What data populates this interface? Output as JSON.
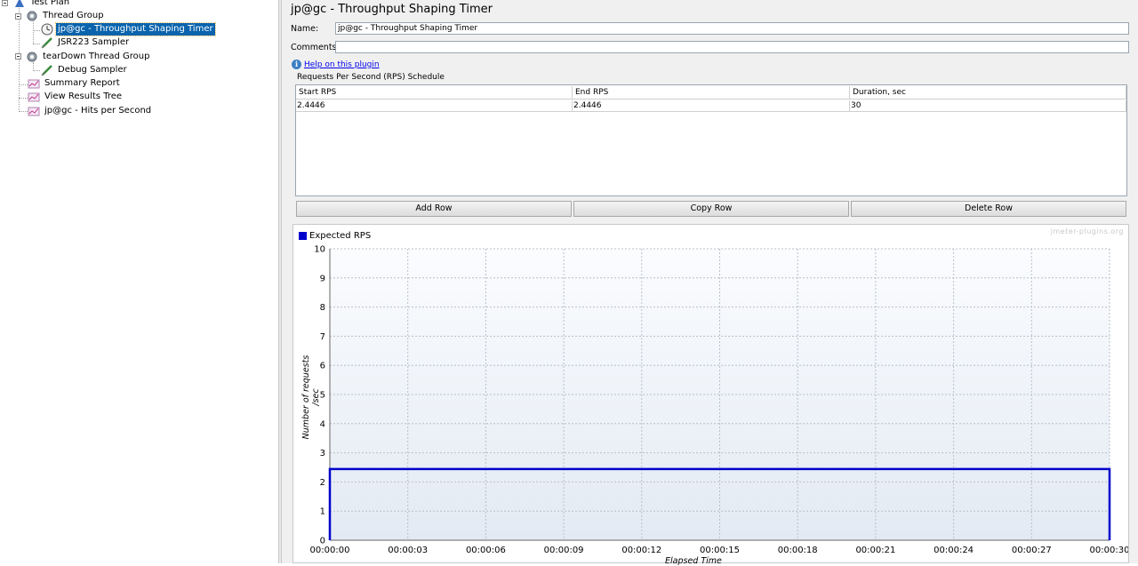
{
  "tree": {
    "items": [
      {
        "label": "Test Plan"
      },
      {
        "label": "Thread Group"
      },
      {
        "label": "jp@gc - Throughput Shaping Timer"
      },
      {
        "label": "JSR223 Sampler"
      },
      {
        "label": "tearDown Thread Group"
      },
      {
        "label": "Debug Sampler"
      },
      {
        "label": "Summary Report"
      },
      {
        "label": "View Results Tree"
      },
      {
        "label": "jp@gc - Hits per Second"
      }
    ]
  },
  "main": {
    "title": "jp@gc - Throughput Shaping Timer",
    "name_label": "Name:",
    "name_value": "jp@gc - Throughput Shaping Timer",
    "comments_label": "Comments:",
    "comments_value": "",
    "help_link": "Help on this plugin",
    "schedule_title": "Requests Per Second (RPS) Schedule",
    "table": {
      "headers": [
        "Start RPS",
        "End RPS",
        "Duration, sec"
      ],
      "rows": [
        [
          "2.4446",
          "2.4446",
          "30"
        ]
      ]
    },
    "buttons": {
      "add_row": "Add Row",
      "copy_row": "Copy Row",
      "delete_row": "Delete Row"
    }
  },
  "chart_data": {
    "type": "line",
    "legend": "Expected RPS",
    "watermark": "jmeter-plugins.org",
    "xlabel": "Elapsed Time",
    "ylabel": "Number of requests /sec",
    "ylim": [
      0,
      10
    ],
    "yticks": [
      "0",
      "1",
      "2",
      "3",
      "4",
      "5",
      "6",
      "7",
      "8",
      "9",
      "10"
    ],
    "xlim": [
      0,
      30
    ],
    "xticks": [
      "00:00:00",
      "00:00:03",
      "00:00:06",
      "00:00:09",
      "00:00:12",
      "00:00:15",
      "00:00:18",
      "00:00:21",
      "00:00:24",
      "00:00:27",
      "00:00:30"
    ],
    "series": [
      {
        "name": "Expected RPS",
        "color": "#0000cc",
        "points": [
          [
            0,
            0
          ],
          [
            0,
            2.4446
          ],
          [
            30,
            2.4446
          ],
          [
            30,
            0
          ]
        ]
      }
    ]
  }
}
